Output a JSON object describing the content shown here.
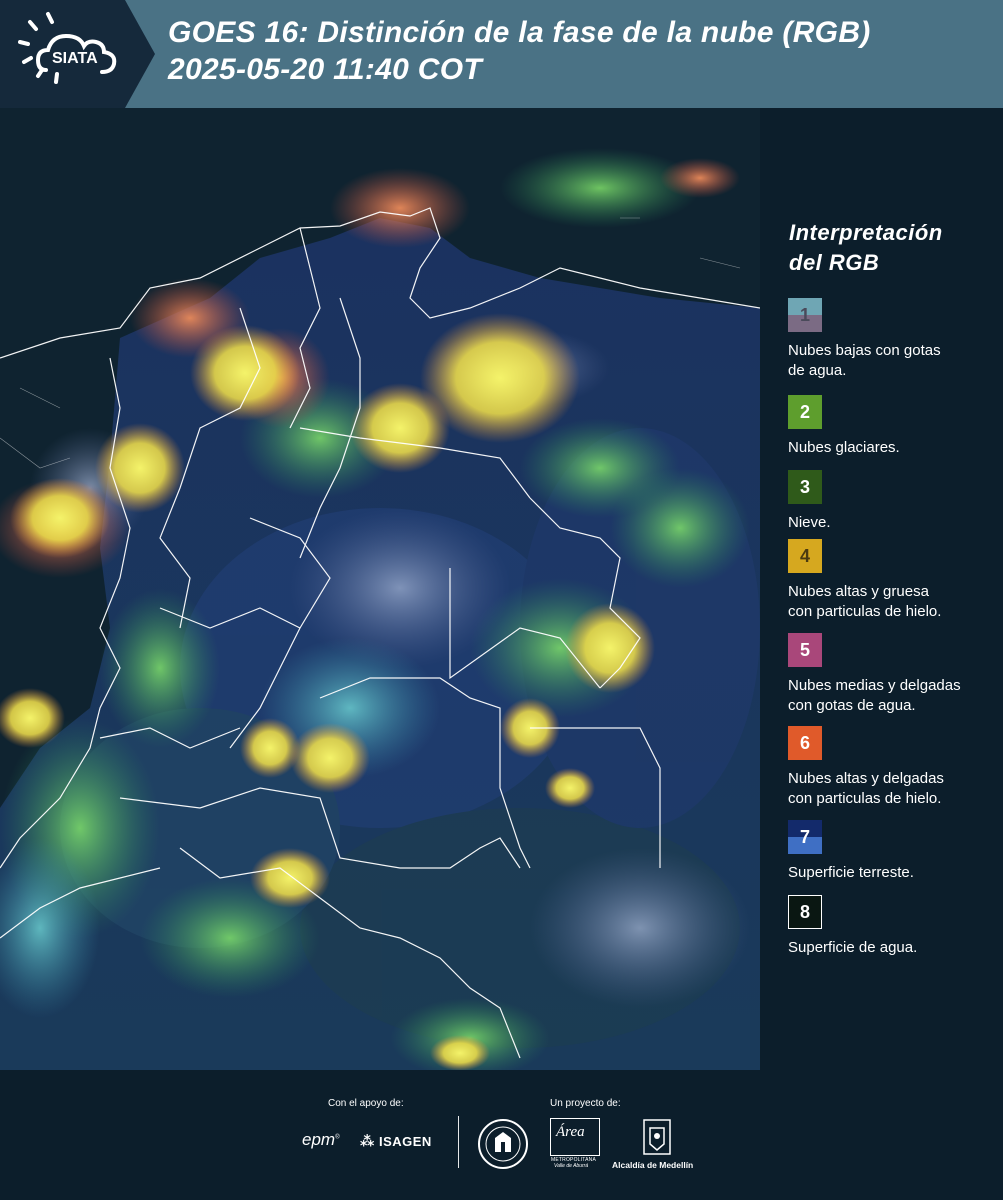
{
  "header": {
    "logo_text": "SIATA",
    "title_line1": "GOES 16: Distinción de la fase de la nube (RGB)",
    "title_line2": " 2025-05-20 11:40 COT"
  },
  "legend": {
    "title_line1": "Interpretación",
    "title_line2": "del RGB",
    "items": [
      {
        "num": "1",
        "label_lines": [
          "Nubes bajas con gotas",
          "de agua."
        ],
        "color_top": "#6fa6b4",
        "color_bottom": "#7b6b84"
      },
      {
        "num": "2",
        "label_lines": [
          "Nubes glaciares."
        ],
        "color_top": "#5e9e2d",
        "color_bottom": "#5e9e2d"
      },
      {
        "num": "3",
        "label_lines": [
          "Nieve."
        ],
        "color_top": "#2f5a1a",
        "color_bottom": "#2f5a1a"
      },
      {
        "num": "4",
        "label_lines": [
          "Nubes altas y gruesa",
          "con particulas de hielo."
        ],
        "color_top": "#d6a81f",
        "color_bottom": "#d6a81f"
      },
      {
        "num": "5",
        "label_lines": [
          "Nubes medias y delgadas",
          "con gotas de agua."
        ],
        "color_top": "#a9477a",
        "color_bottom": "#a9477a"
      },
      {
        "num": "6",
        "label_lines": [
          "Nubes altas y delgadas",
          "con particulas de hielo."
        ],
        "color_top": "#e05a2a",
        "color_bottom": "#e05a2a"
      },
      {
        "num": "7",
        "label_lines": [
          "Superficie terreste."
        ],
        "color_top": "#132a6b",
        "color_bottom": "#3f6fc4"
      },
      {
        "num": "8",
        "label_lines": [
          "Superficie de agua."
        ],
        "color_top": "#0a1712",
        "color_bottom": "#0a1712"
      }
    ]
  },
  "footer": {
    "support_caption": "Con el apoyo de:",
    "project_caption": "Un proyecto de:",
    "sponsor_epm": "epm",
    "sponsor_isagen": "ISAGEN",
    "area_logo_text": "Área",
    "area_logo_subtext": "METROPOLITANA",
    "area_logo_subtext2": "Valle de Aburrá",
    "alcaldia_text": "Alcaldía de Medellín"
  }
}
